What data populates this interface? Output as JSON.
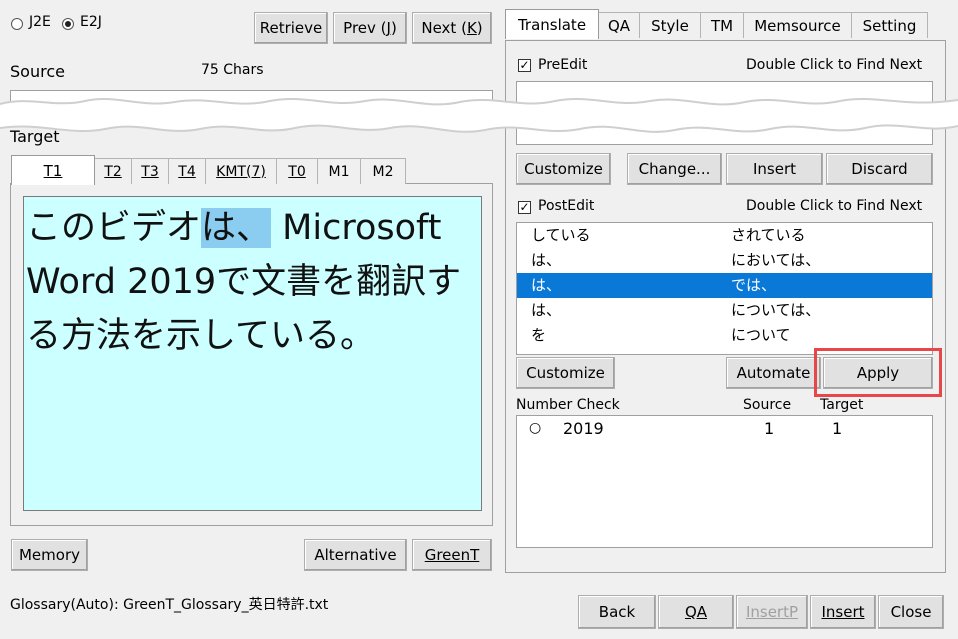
{
  "mode": {
    "j2e": "J2E",
    "e2j": "E2J",
    "selected": "E2J"
  },
  "nav_buttons": {
    "retrieve": "Retrieve",
    "prev": "Prev",
    "prev_key": "J",
    "next": "Next",
    "next_key": "K"
  },
  "source": {
    "label": "Source",
    "chars": "75 Chars"
  },
  "target": {
    "label": "Target",
    "tabs": [
      "T1",
      "T2",
      "T3",
      "T4",
      "KMT(7)",
      "T0",
      "M1",
      "M2"
    ],
    "active_tab": "T1",
    "text_before": "このビデオ",
    "text_highlight": "は、",
    "text_after": "Microsoft Word 2019で文書を翻訳する方法を示している。"
  },
  "bottom_left": {
    "memory": "Memory",
    "alternative": "Alternative",
    "greent": "GreenT"
  },
  "right_tabs": [
    "Translate",
    "QA",
    "Style",
    "TM",
    "Memsource",
    "Setting"
  ],
  "active_right_tab": "Translate",
  "preedit": {
    "label": "PreEdit",
    "checked": true,
    "hint": "Double Click to Find Next",
    "buttons": {
      "customize": "Customize",
      "change": "Change...",
      "insert": "Insert",
      "discard": "Discard"
    }
  },
  "postedit": {
    "label": "PostEdit",
    "checked": true,
    "hint": "Double Click to Find Next",
    "rows": [
      {
        "from": "している",
        "to": "されている"
      },
      {
        "from": "は、",
        "to": "においては、"
      },
      {
        "from": "は、",
        "to": "では、"
      },
      {
        "from": "は、",
        "to": "については、"
      },
      {
        "from": "を",
        "to": "について"
      }
    ],
    "selected_index": 2,
    "buttons": {
      "customize": "Customize",
      "automate": "Automate",
      "apply": "Apply"
    }
  },
  "number_check": {
    "label": "Number Check",
    "col_source": "Source",
    "col_target": "Target",
    "rows": [
      {
        "mark": "○",
        "value": "2019",
        "source": "1",
        "target": "1"
      }
    ]
  },
  "status": {
    "glossary": "Glossary(Auto): GreenT_Glossary_英日特許.txt"
  },
  "footer_buttons": {
    "back": "Back",
    "qa": "QA",
    "insertp": "InsertP",
    "insert": "Insert",
    "close": "Close"
  },
  "colors": {
    "target_bg": "#ccffff",
    "selection": "#0a78d7",
    "highlight": "#8acdf0",
    "callout": "#e8474a"
  }
}
